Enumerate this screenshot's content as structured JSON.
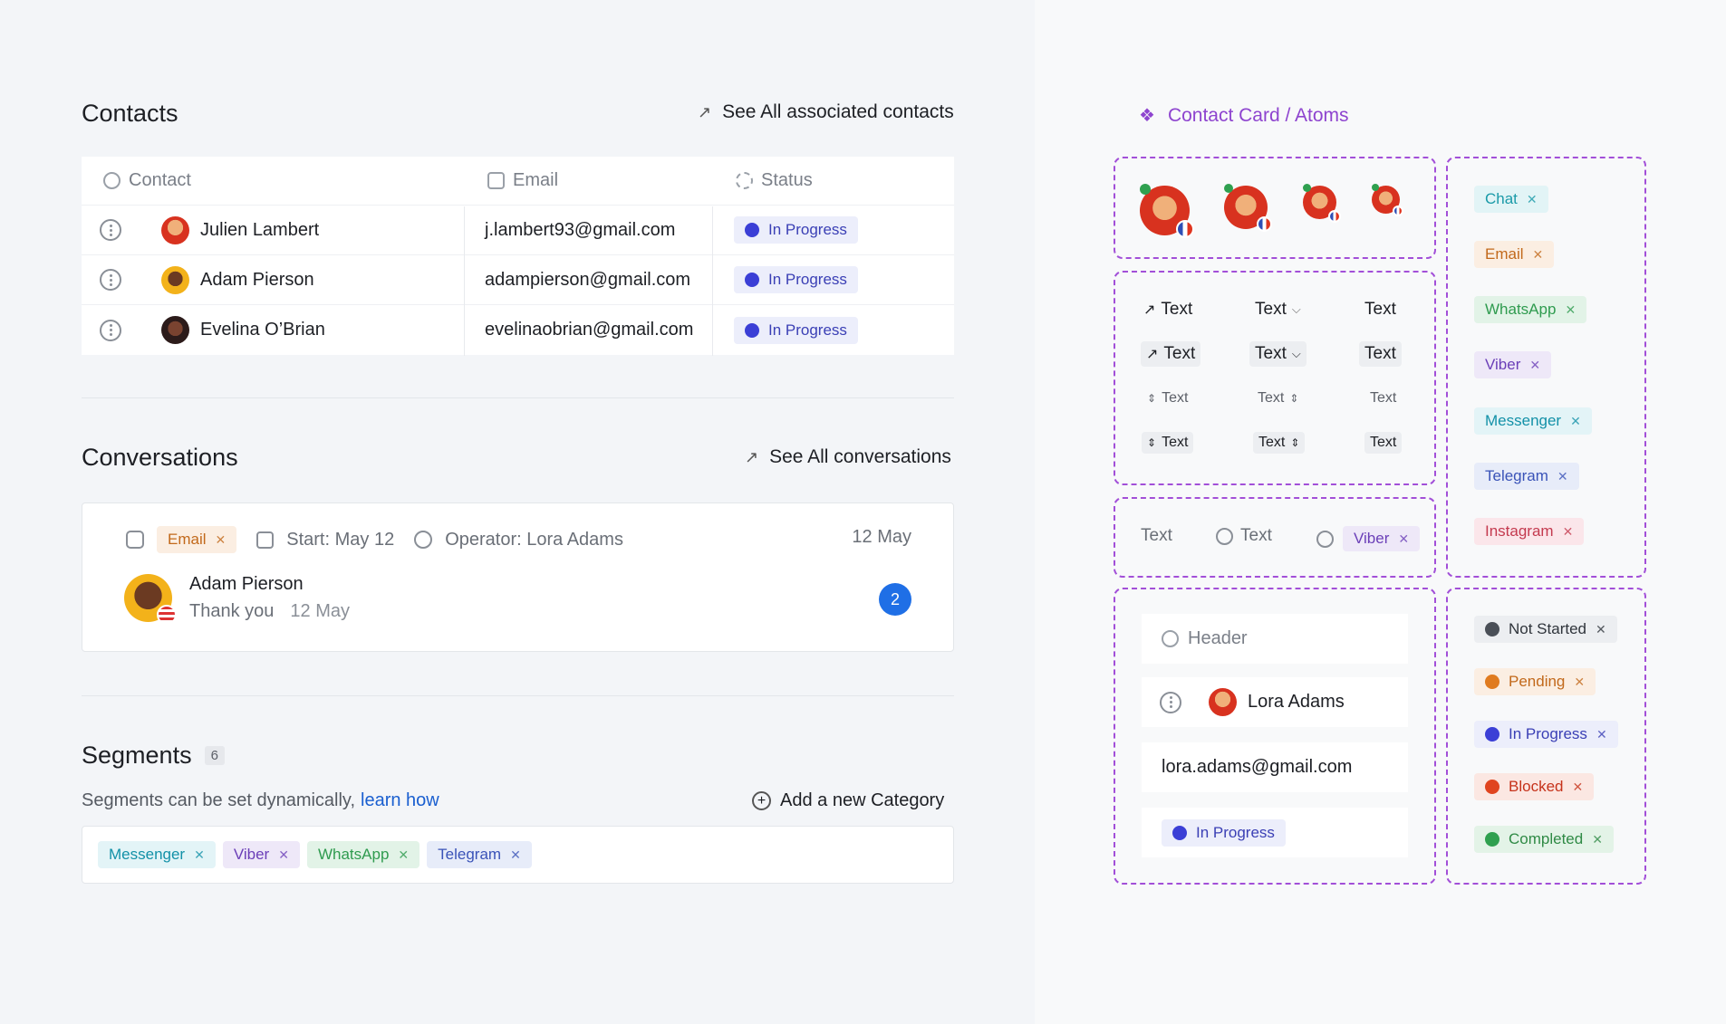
{
  "contacts": {
    "title": "Contacts",
    "see_all": "See All associated contacts",
    "headers": {
      "contact": "Contact",
      "email": "Email",
      "status": "Status"
    },
    "rows": [
      {
        "name": "Julien Lambert",
        "email": "j.lambert93@gmail.com",
        "status": "In Progress"
      },
      {
        "name": "Adam Pierson",
        "email": "adampierson@gmail.com",
        "status": "In Progress"
      },
      {
        "name": "Evelina O’Brian",
        "email": "evelinaobrian@gmail.com",
        "status": "In Progress"
      }
    ]
  },
  "conversations": {
    "title": "Conversations",
    "see_all": "See All conversations",
    "card": {
      "channel": "Email",
      "start": "Start: May 12",
      "operator": "Operator: Lora Adams",
      "date": "12 May",
      "name": "Adam Pierson",
      "message": "Thank you",
      "message_date": "12 May",
      "unread_count": "2"
    }
  },
  "segments": {
    "title": "Segments",
    "count": "6",
    "description": "Segments can be set dynamically,",
    "learn_link": "learn how",
    "add_label": "Add a new Category",
    "tags": [
      {
        "label": "Messenger",
        "color": "#1391a8",
        "bg": "#e3f4f7"
      },
      {
        "label": "Viber",
        "color": "#6b3fb8",
        "bg": "#eee8f8"
      },
      {
        "label": "WhatsApp",
        "color": "#2f9b4f",
        "bg": "#e2f3e7"
      },
      {
        "label": "Telegram",
        "color": "#3a53b8",
        "bg": "#e7ecf9"
      }
    ]
  },
  "atoms": {
    "title": "Contact Card / Atoms",
    "text_label": "Text",
    "viber_label": "Viber",
    "header_label": "Header",
    "operator_name": "Lora Adams",
    "operator_email": "lora.adams@gmail.com",
    "status_label": "In Progress",
    "channel_tags": [
      {
        "label": "Chat",
        "color": "#1a9aa8",
        "bg": "#e2f4f6"
      },
      {
        "label": "Email",
        "color": "#c2691b",
        "bg": "#fbeee2"
      },
      {
        "label": "WhatsApp",
        "color": "#2f9b4f",
        "bg": "#e2f3e7"
      },
      {
        "label": "Viber",
        "color": "#6b3fb8",
        "bg": "#eee8f8"
      },
      {
        "label": "Messenger",
        "color": "#1391a8",
        "bg": "#e3f4f7"
      },
      {
        "label": "Telegram",
        "color": "#3a53b8",
        "bg": "#e7ecf9"
      },
      {
        "label": "Instagram",
        "color": "#c43a4f",
        "bg": "#fbe6ea"
      }
    ],
    "status_tags": [
      {
        "label": "Not Started",
        "color": "#2f343b",
        "dot": "#4a4f57",
        "bg": "#eceef1"
      },
      {
        "label": "Pending",
        "color": "#c2691b",
        "dot": "#e07b1f",
        "bg": "#fbeee2"
      },
      {
        "label": "In Progress",
        "color": "#3a3fb5",
        "dot": "#3b3fd6",
        "bg": "#eceefb"
      },
      {
        "label": "Blocked",
        "color": "#c6321a",
        "dot": "#e0441f",
        "bg": "#fbe7e2"
      },
      {
        "label": "Completed",
        "color": "#2f8a45",
        "dot": "#2fa04f",
        "bg": "#e3f3e7"
      }
    ]
  },
  "colors": {
    "accent_purple": "#a24fd8",
    "link_blue": "#1a5fd0",
    "badge_blue": "#1f6fe6"
  }
}
